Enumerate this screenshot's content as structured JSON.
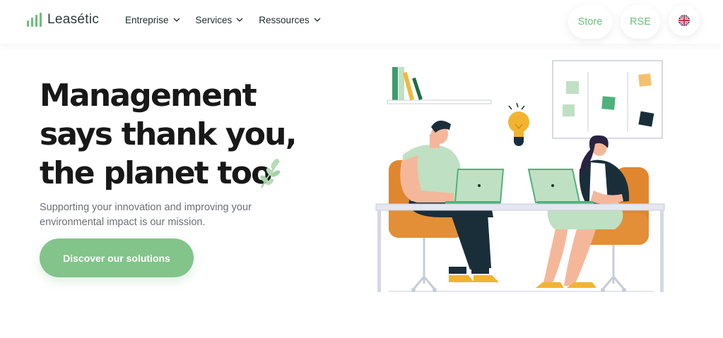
{
  "brand": {
    "name": "Leasétic",
    "accent": "#82c48a"
  },
  "nav": {
    "items": [
      {
        "label": "Entreprise"
      },
      {
        "label": "Services"
      },
      {
        "label": "Ressources"
      }
    ]
  },
  "header_actions": {
    "store": "Store",
    "rse": "RSE",
    "language_icon": "uk-flag-icon"
  },
  "hero": {
    "title_line1": "Management",
    "title_line2": "says thank you,",
    "title_line3": "the planet too",
    "subtitle": "Supporting your innovation and improving your environmental impact is our mission.",
    "cta": "Discover our solutions"
  }
}
